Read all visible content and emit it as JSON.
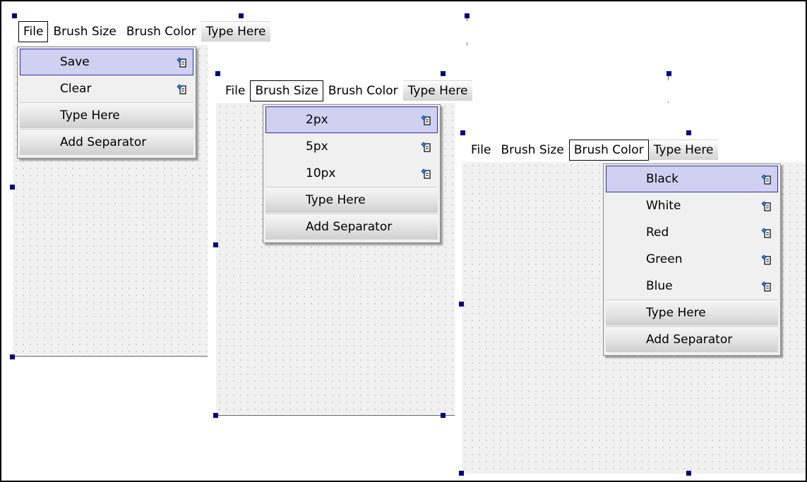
{
  "windows": [
    {
      "menubar": [
        "File",
        "Brush Size",
        "Brush Color",
        "Type Here"
      ],
      "open_menu": "File",
      "menu_items": [
        {
          "label": "Save",
          "selected": true,
          "icon": "action-icon"
        },
        {
          "label": "Clear",
          "selected": false,
          "icon": "action-icon"
        },
        {
          "label": "Type Here",
          "placeholder": true
        },
        {
          "label": "Add Separator",
          "placeholder": true
        }
      ]
    },
    {
      "menubar": [
        "File",
        "Brush Size",
        "Brush Color",
        "Type Here"
      ],
      "open_menu": "Brush Size",
      "menu_items": [
        {
          "label": "2px",
          "selected": true,
          "icon": "action-icon"
        },
        {
          "label": "5px",
          "selected": false,
          "icon": "action-icon"
        },
        {
          "label": "10px",
          "selected": false,
          "icon": "action-icon"
        },
        {
          "label": "Type Here",
          "placeholder": true
        },
        {
          "label": "Add Separator",
          "placeholder": true
        }
      ]
    },
    {
      "menubar": [
        "File",
        "Brush Size",
        "Brush Color",
        "Type Here"
      ],
      "open_menu": "Brush Color",
      "menu_items": [
        {
          "label": "Black",
          "selected": true,
          "icon": "action-icon"
        },
        {
          "label": "White",
          "selected": false,
          "icon": "action-icon"
        },
        {
          "label": "Red",
          "selected": false,
          "icon": "action-icon"
        },
        {
          "label": "Green",
          "selected": false,
          "icon": "action-icon"
        },
        {
          "label": "Blue",
          "selected": false,
          "icon": "action-icon"
        },
        {
          "label": "Type Here",
          "placeholder": true
        },
        {
          "label": "Add Separator",
          "placeholder": true
        }
      ]
    }
  ],
  "colors": {
    "selection_fill": "#d0d0f0",
    "selection_border": "#2e2eb8",
    "handle": "#000080",
    "form_background": "#f1f1f1"
  }
}
